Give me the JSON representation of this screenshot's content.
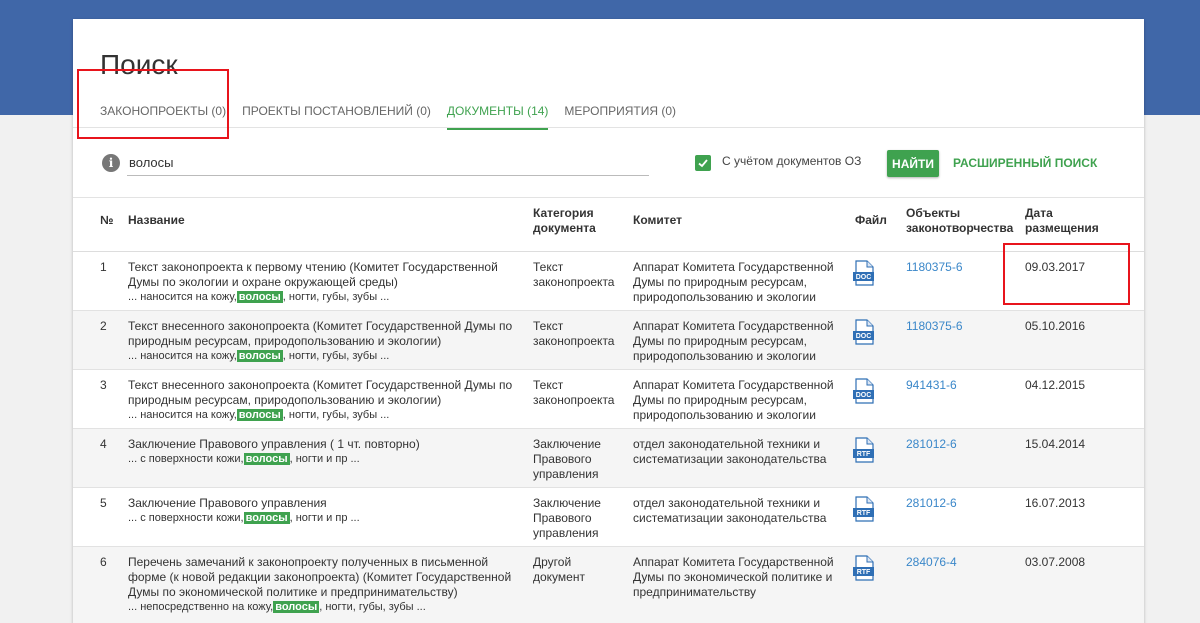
{
  "page": {
    "title": "Поиск"
  },
  "tabs": [
    {
      "label": "Законопроекты (0)",
      "active": false
    },
    {
      "label": "Проекты постановлений (0)",
      "active": false
    },
    {
      "label": "Документы (14)",
      "active": true
    },
    {
      "label": "Мероприятия (0)",
      "active": false
    }
  ],
  "search": {
    "value": "волосы",
    "oz_label": "С учётом документов ОЗ",
    "oz_checked": true,
    "find_label": "Найти",
    "advanced_label": "Расширенный поиск"
  },
  "table": {
    "headers": {
      "num": "№",
      "name": "Название",
      "category": "Категория документа",
      "committee": "Комитет",
      "file": "Файл",
      "objects": "Объекты законотворчества",
      "date": "Дата размещения"
    },
    "rows": [
      {
        "num": "1",
        "name": "Текст законопроекта к первому чтению (Комитет Государственной Думы по экологии и охране окружающей среды)",
        "snippet_pre": "... наносится на кожу,",
        "snippet_hl": "волосы",
        "snippet_post": ", ногти, губы, зубы ...",
        "category": "Текст законопроекта",
        "committee": "Аппарат Комитета Государственной Думы по природным ресурсам, природопользованию и экологии",
        "file": "DOC",
        "object": "1180375-6",
        "date": "09.03.2017"
      },
      {
        "num": "2",
        "name": "Текст внесенного законопроекта (Комитет Государственной Думы по природным ресурсам, природопользованию и экологии)",
        "snippet_pre": "... наносится на кожу,",
        "snippet_hl": "волосы",
        "snippet_post": ", ногти, губы, зубы ...",
        "category": "Текст законопроекта",
        "committee": "Аппарат Комитета Государственной Думы по природным ресурсам, природопользованию и экологии",
        "file": "DOC",
        "object": "1180375-6",
        "date": "05.10.2016"
      },
      {
        "num": "3",
        "name": "Текст внесенного законопроекта (Комитет Государственной Думы по природным ресурсам, природопользованию и экологии)",
        "snippet_pre": "... наносится на кожу,",
        "snippet_hl": "волосы",
        "snippet_post": ", ногти, губы, зубы ...",
        "category": "Текст законопроекта",
        "committee": "Аппарат Комитета Государственной Думы по природным ресурсам, природопользованию и экологии",
        "file": "DOC",
        "object": "941431-6",
        "date": "04.12.2015"
      },
      {
        "num": "4",
        "name": "Заключение Правового управления ( 1 чт. повторно)",
        "snippet_pre": "... с поверхности кожи,",
        "snippet_hl": "волосы",
        "snippet_post": ", ногти и пр ...",
        "category": "Заключение Правового управления",
        "committee": "отдел законодательной техники и систематизации законодательства",
        "file": "RTF",
        "object": "281012-6",
        "date": "15.04.2014"
      },
      {
        "num": "5",
        "name": "Заключение Правового управления",
        "snippet_pre": "... с поверхности кожи,",
        "snippet_hl": "волосы",
        "snippet_post": ", ногти и пр ...",
        "category": "Заключение Правового управления",
        "committee": "отдел законодательной техники и систематизации законодательства",
        "file": "RTF",
        "object": "281012-6",
        "date": "16.07.2013"
      },
      {
        "num": "6",
        "name": "Перечень замечаний к законопроекту полученных в письменной форме (к новой редакции законопроекта) (Комитет Государственной Думы по экономической политике и предпринимательству)",
        "snippet_pre": "... непосредственно на кожу,",
        "snippet_hl": "волосы",
        "snippet_post": ", ногти, губы, зубы ...",
        "category": "Другой документ",
        "committee": "Аппарат Комитета Государственной Думы по экономической политике и предпринимательству",
        "file": "RTF",
        "object": "284076-4",
        "date": "03.07.2008"
      }
    ]
  },
  "colors": {
    "accent": "#3fa24f",
    "header_band": "#4067a8",
    "link": "#3a87c9",
    "annotation": "#e8141c",
    "doc_icon": "#2f6fb5"
  }
}
